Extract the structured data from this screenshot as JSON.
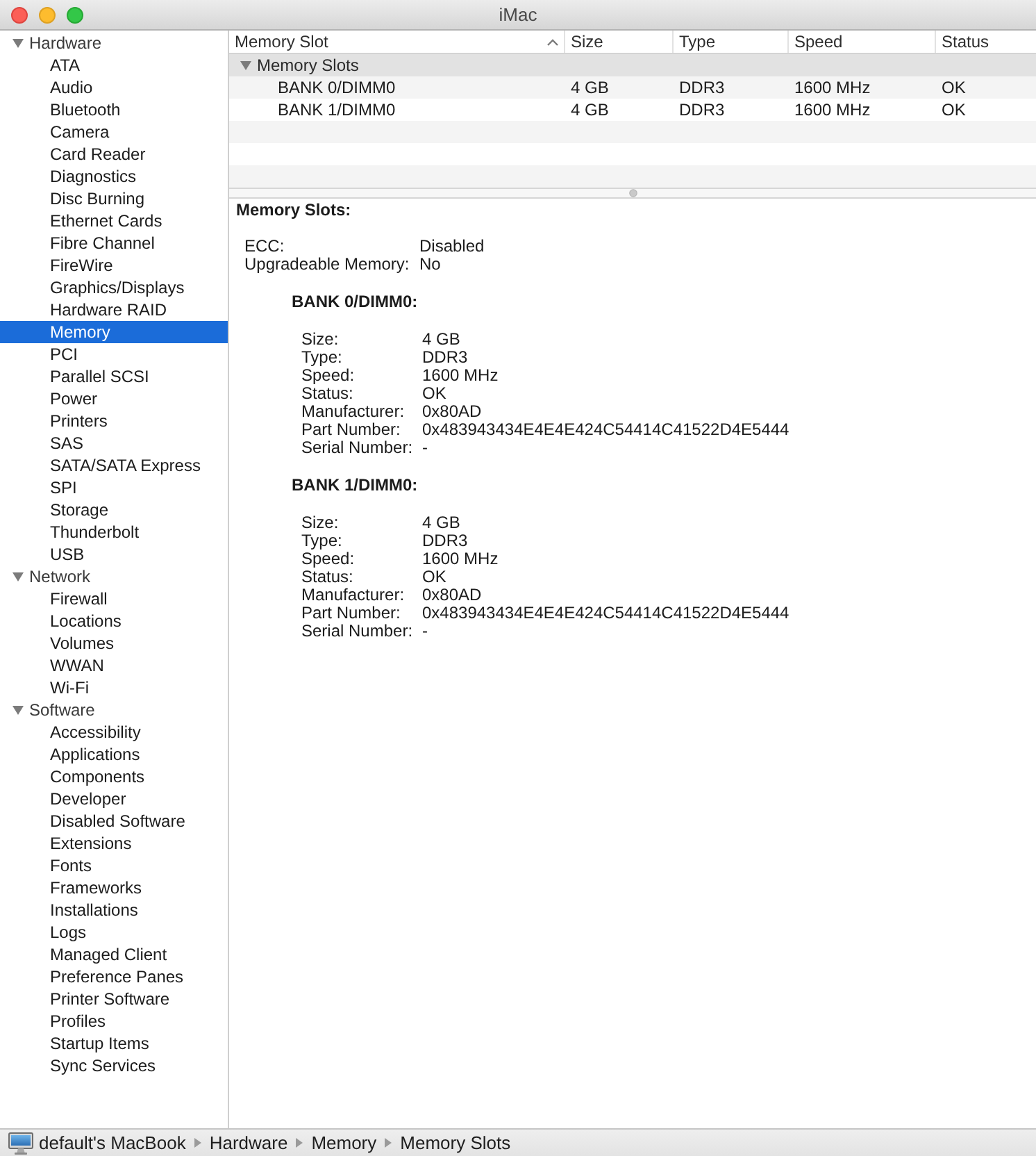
{
  "window": {
    "title": "iMac"
  },
  "sidebar": {
    "sections": [
      {
        "label": "Hardware",
        "expanded": true,
        "selected": false,
        "children": [
          {
            "label": "ATA",
            "selected": false
          },
          {
            "label": "Audio",
            "selected": false
          },
          {
            "label": "Bluetooth",
            "selected": false
          },
          {
            "label": "Camera",
            "selected": false
          },
          {
            "label": "Card Reader",
            "selected": false
          },
          {
            "label": "Diagnostics",
            "selected": false
          },
          {
            "label": "Disc Burning",
            "selected": false
          },
          {
            "label": "Ethernet Cards",
            "selected": false
          },
          {
            "label": "Fibre Channel",
            "selected": false
          },
          {
            "label": "FireWire",
            "selected": false
          },
          {
            "label": "Graphics/Displays",
            "selected": false
          },
          {
            "label": "Hardware RAID",
            "selected": false
          },
          {
            "label": "Memory",
            "selected": true
          },
          {
            "label": "PCI",
            "selected": false
          },
          {
            "label": "Parallel SCSI",
            "selected": false
          },
          {
            "label": "Power",
            "selected": false
          },
          {
            "label": "Printers",
            "selected": false
          },
          {
            "label": "SAS",
            "selected": false
          },
          {
            "label": "SATA/SATA Express",
            "selected": false
          },
          {
            "label": "SPI",
            "selected": false
          },
          {
            "label": "Storage",
            "selected": false
          },
          {
            "label": "Thunderbolt",
            "selected": false
          },
          {
            "label": "USB",
            "selected": false
          }
        ]
      },
      {
        "label": "Network",
        "expanded": true,
        "selected": false,
        "children": [
          {
            "label": "Firewall",
            "selected": false
          },
          {
            "label": "Locations",
            "selected": false
          },
          {
            "label": "Volumes",
            "selected": false
          },
          {
            "label": "WWAN",
            "selected": false
          },
          {
            "label": "Wi-Fi",
            "selected": false
          }
        ]
      },
      {
        "label": "Software",
        "expanded": true,
        "selected": false,
        "children": [
          {
            "label": "Accessibility",
            "selected": false
          },
          {
            "label": "Applications",
            "selected": false
          },
          {
            "label": "Components",
            "selected": false
          },
          {
            "label": "Developer",
            "selected": false
          },
          {
            "label": "Disabled Software",
            "selected": false
          },
          {
            "label": "Extensions",
            "selected": false
          },
          {
            "label": "Fonts",
            "selected": false
          },
          {
            "label": "Frameworks",
            "selected": false
          },
          {
            "label": "Installations",
            "selected": false
          },
          {
            "label": "Logs",
            "selected": false
          },
          {
            "label": "Managed Client",
            "selected": false
          },
          {
            "label": "Preference Panes",
            "selected": false
          },
          {
            "label": "Printer Software",
            "selected": false
          },
          {
            "label": "Profiles",
            "selected": false
          },
          {
            "label": "Startup Items",
            "selected": false
          },
          {
            "label": "Sync Services",
            "selected": false
          }
        ]
      }
    ]
  },
  "table": {
    "columns": [
      {
        "label": "Memory Slot",
        "sorted": true
      },
      {
        "label": "Size",
        "sorted": false
      },
      {
        "label": "Type",
        "sorted": false
      },
      {
        "label": "Speed",
        "sorted": false
      },
      {
        "label": "Status",
        "sorted": false
      }
    ],
    "groups": [
      {
        "label": "Memory Slots",
        "expanded": true,
        "rows": [
          {
            "cells": [
              "BANK 0/DIMM0",
              "4 GB",
              "DDR3",
              "1600 MHz",
              "OK"
            ]
          },
          {
            "cells": [
              "BANK 1/DIMM0",
              "4 GB",
              "DDR3",
              "1600 MHz",
              "OK"
            ]
          }
        ]
      }
    ]
  },
  "detail": {
    "title": "Memory Slots:",
    "fields": [
      {
        "label": "ECC:",
        "value": "Disabled"
      },
      {
        "label": "Upgradeable Memory:",
        "value": "No"
      }
    ],
    "banks": [
      {
        "title": "BANK 0/DIMM0:",
        "fields": [
          {
            "label": "Size:",
            "value": "4 GB"
          },
          {
            "label": "Type:",
            "value": "DDR3"
          },
          {
            "label": "Speed:",
            "value": "1600 MHz"
          },
          {
            "label": "Status:",
            "value": "OK"
          },
          {
            "label": "Manufacturer:",
            "value": "0x80AD"
          },
          {
            "label": "Part Number:",
            "value": "0x483943434E4E4E424C54414C41522D4E5444"
          },
          {
            "label": "Serial Number:",
            "value": "-"
          }
        ]
      },
      {
        "title": "BANK 1/DIMM0:",
        "fields": [
          {
            "label": "Size:",
            "value": "4 GB"
          },
          {
            "label": "Type:",
            "value": "DDR3"
          },
          {
            "label": "Speed:",
            "value": "1600 MHz"
          },
          {
            "label": "Status:",
            "value": "OK"
          },
          {
            "label": "Manufacturer:",
            "value": "0x80AD"
          },
          {
            "label": "Part Number:",
            "value": "0x483943434E4E4E424C54414C41522D4E5444"
          },
          {
            "label": "Serial Number:",
            "value": "-"
          }
        ]
      }
    ]
  },
  "status_bar": {
    "path": [
      "default's MacBook",
      "Hardware",
      "Memory",
      "Memory Slots"
    ]
  }
}
